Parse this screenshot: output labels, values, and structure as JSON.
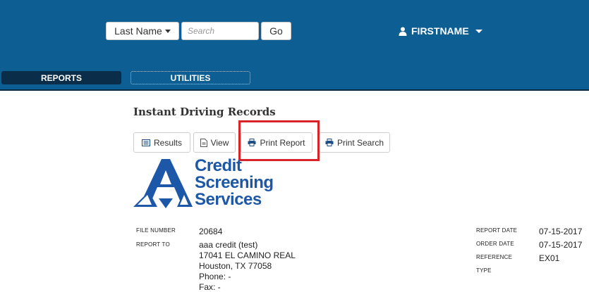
{
  "header": {
    "sort_select": {
      "selected": "Last Name"
    },
    "search": {
      "placeholder": "Search",
      "value": ""
    },
    "go_label": "Go",
    "user_name": "FIRSTNAME"
  },
  "nav": {
    "reports_label": "REPORTS",
    "utilities_label": "UTILITIES"
  },
  "page": {
    "title": "Instant Driving Records"
  },
  "toolbar": {
    "results_label": "Results",
    "view_label": "View",
    "print_report_label": "Print Report",
    "print_search_label": "Print Search"
  },
  "logo": {
    "line1": "Credit",
    "line2": "Screening",
    "line3": "Services"
  },
  "report": {
    "file_number_label": "FILE NUMBER",
    "file_number": "20684",
    "report_to_label": "REPORT TO",
    "report_to": [
      "aaa credit (test)",
      "17041 EL CAMINO REAL",
      "Houston, TX 77058",
      "Phone: -",
      "Fax: -"
    ],
    "report_date_label": "REPORT DATE",
    "report_date": "07-15-2017",
    "order_date_label": "ORDER DATE",
    "order_date": "07-15-2017",
    "reference_label": "REFERENCE",
    "reference": "EX01",
    "type_label": "TYPE",
    "type": ""
  },
  "colors": {
    "header_bg": "#0d5e93",
    "active_tab_bg": "#0a2d4a",
    "highlight": "#d8232a",
    "logo_blue": "#1d57a7"
  }
}
